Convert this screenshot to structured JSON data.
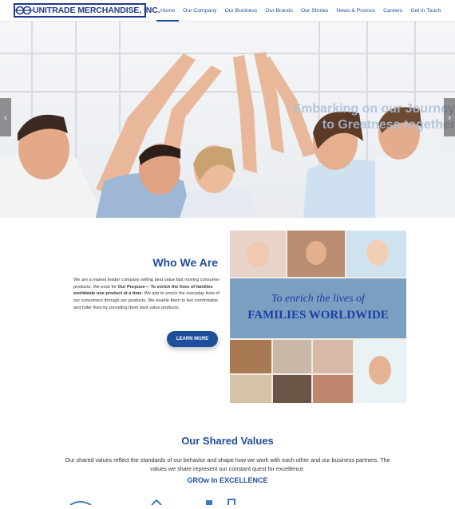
{
  "header": {
    "logo_text": "UNITRADE MERCHANDISE, INC.",
    "nav": [
      {
        "label": "Home",
        "active": true
      },
      {
        "label": "Our Company",
        "active": false
      },
      {
        "label": "Our Business",
        "active": false
      },
      {
        "label": "Our Brands",
        "active": false
      },
      {
        "label": "Our Stories",
        "active": false
      },
      {
        "label": "News & Promos",
        "active": false
      },
      {
        "label": "Careers",
        "active": false
      },
      {
        "label": "Get in Touch",
        "active": false
      }
    ]
  },
  "hero": {
    "caption_line1": "Embarking on our Journey",
    "caption_line2": "to Greatness together",
    "prev_icon": "chevron-left-icon",
    "next_icon": "chevron-right-icon"
  },
  "who": {
    "title": "Who We Are",
    "text_1": "We are a market leader company selling best value fast moving consumer products. We exist for ",
    "text_bold": "Our Purpose— To enrich the lives of families worldwide one product at a time",
    "text_2": ". We aim to enrich the everyday lives of our consumers through our products. We enable them to live comfortable and fuller lives by providing them best value products.",
    "button": "LEARN MORE",
    "collage_line1": "To enrich the lives of",
    "collage_line2": "FAMILIES WORLDWIDE"
  },
  "values": {
    "title": "Our Shared Values",
    "text": "Our shared values reflect the standards of our behavior and shape how we work with each other and our business partners. The values we share represent our constant quest for excellence.",
    "subtitle": "GROw In EXCELLENCE"
  },
  "colors": {
    "brand": "#1f4e9c",
    "logo": "#1f3a8a"
  }
}
